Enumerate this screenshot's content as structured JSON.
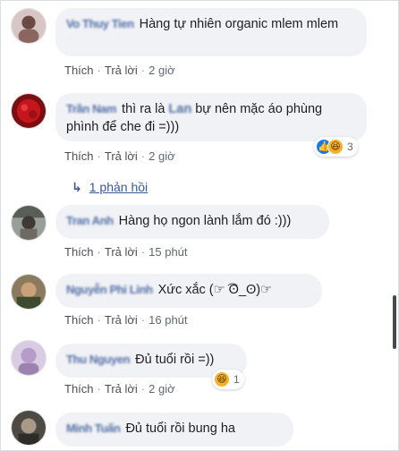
{
  "actions": {
    "like": "Thích",
    "reply": "Trả lời",
    "sep": "·"
  },
  "comments": [
    {
      "author": "Vo Thuy Tien",
      "text": "Hàng tự nhiên organic mlem mlem",
      "time": "2 giờ"
    },
    {
      "author": "Trần Nam",
      "text_before": "thì ra là",
      "mention": "Lan",
      "text_after": "bự nên mặc áo phùng phình để che đi =)))",
      "time": "2 giờ",
      "reaction_count": "3"
    },
    {
      "author": "Tran Anh",
      "text": "Hàng họ ngon lành lắm đó :)))",
      "time": "15 phút"
    },
    {
      "author": "Nguyễn Phi Linh",
      "text": "Xức xắc (☞ ͡ʘ_ʘ)☞",
      "time": "16 phút"
    },
    {
      "author": "Thu Nguyen",
      "text": "Đủ tuổi rồi =))",
      "time": "2 giờ",
      "reaction_count": "1"
    },
    {
      "author": "Minh Tuấn",
      "text": "Đủ tuổi rồi bung ha"
    }
  ],
  "replies_link": "1 phản hồi",
  "icons": {
    "reply_arrow": "reply-arrow-icon",
    "like": "like-reaction-icon",
    "haha": "haha-reaction-icon"
  }
}
